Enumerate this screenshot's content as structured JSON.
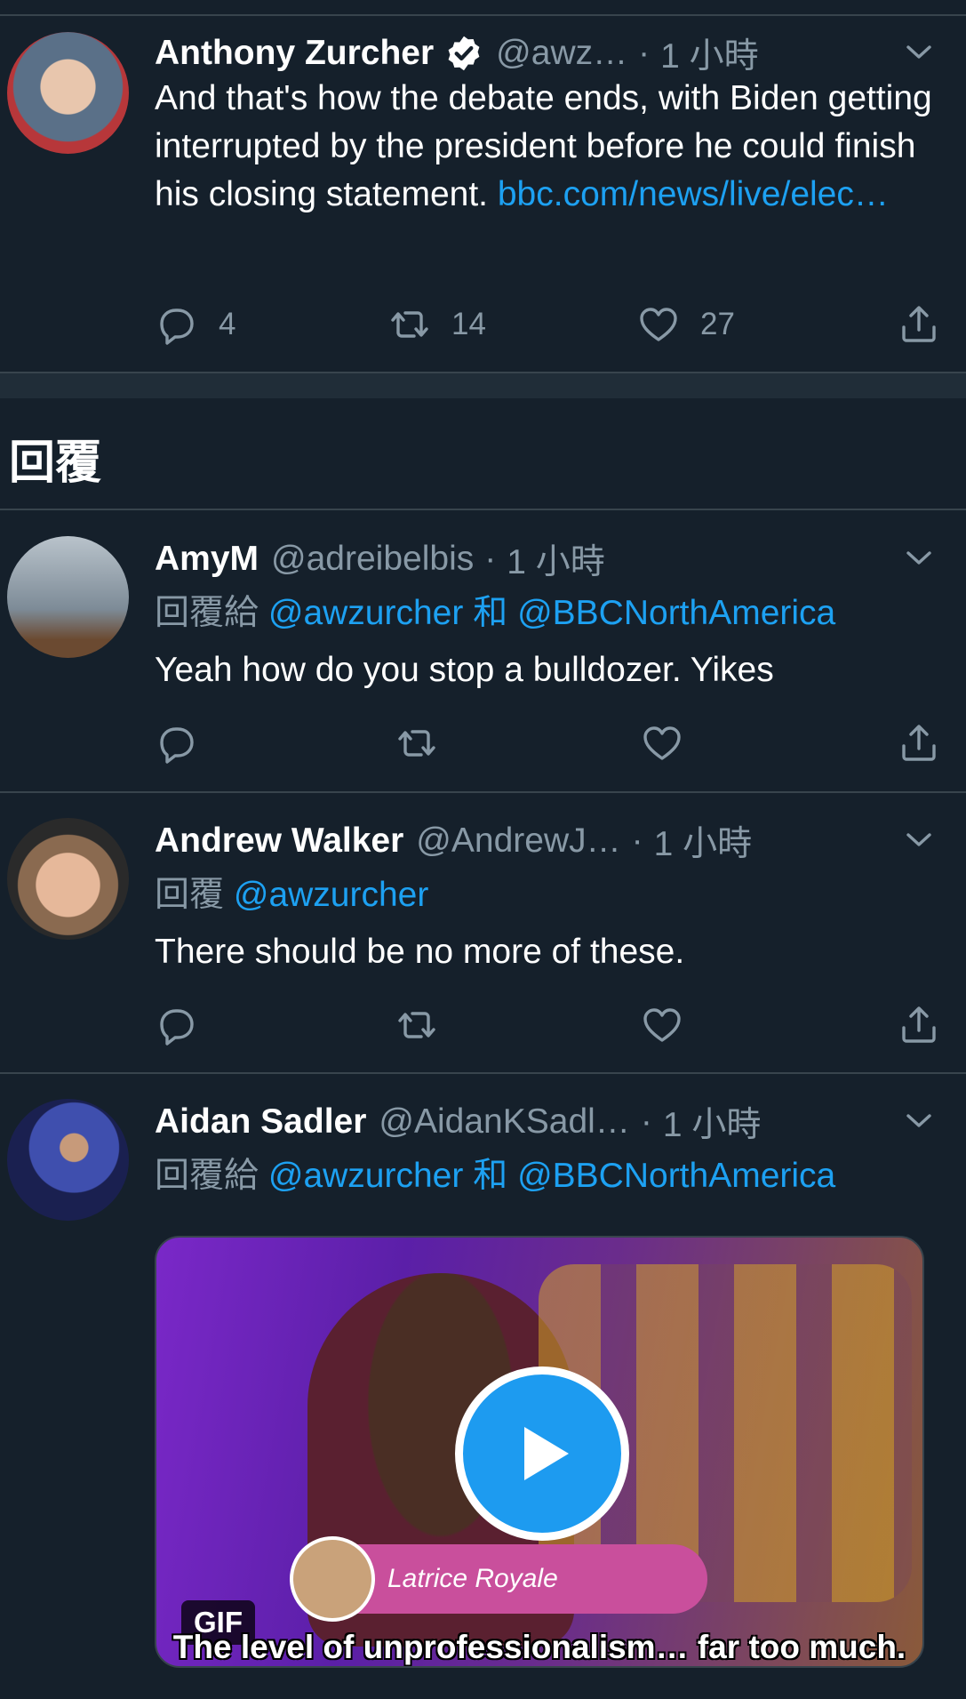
{
  "colors": {
    "background": "#15202b",
    "accent": "#1da1f2",
    "muted": "#8899a6",
    "divider": "#38444d"
  },
  "main_tweet": {
    "name": "Anthony Zurcher",
    "handle": "@awz…",
    "time": "1 小時",
    "text": "And that's how the debate ends, with Biden getting interrupted by the president before he could finish his closing statement.",
    "link": "bbc.com/news/live/elec…",
    "replies": "4",
    "retweets": "14",
    "likes": "27"
  },
  "section_title": "回覆",
  "replies": [
    {
      "name": "AmyM",
      "handle": "@adreibelbis",
      "time": "1 小時",
      "reply_prefix": "回覆給",
      "mention1": "@awzurcher",
      "conj": "和",
      "mention2": "@BBCNorthAmerica",
      "text": "Yeah how do you stop a bulldozer.  Yikes"
    },
    {
      "name": "Andrew Walker",
      "handle": "@AndrewJ…",
      "time": "1 小時",
      "reply_prefix": "回覆",
      "mention1": "@awzurcher",
      "text": "There should be no more of these."
    },
    {
      "name": "Aidan Sadler",
      "handle": "@AidanKSadl…",
      "time": "1 小時",
      "reply_prefix": "回覆給",
      "mention1": "@awzurcher",
      "conj": "和",
      "mention2": "@BBCNorthAmerica",
      "media": {
        "badge": "GIF",
        "nameplate": "Latrice Royale",
        "caption": "The level of unprofessionalism… far too much."
      }
    }
  ],
  "icons": [
    "verified-icon",
    "chevron-down-icon",
    "reply-icon",
    "retweet-icon",
    "like-icon",
    "share-icon",
    "play-icon"
  ]
}
